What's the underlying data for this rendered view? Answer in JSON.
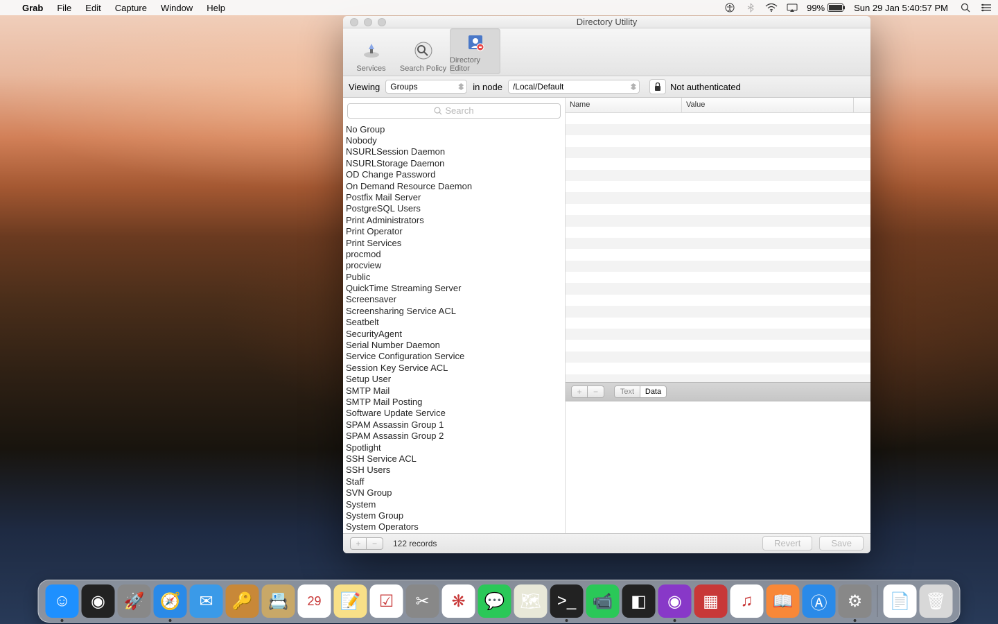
{
  "menubar": {
    "app": "Grab",
    "items": [
      "File",
      "Edit",
      "Capture",
      "Window",
      "Help"
    ],
    "battery": "99%",
    "clock": "Sun 29 Jan  5:40:57 PM"
  },
  "window": {
    "title": "Directory Utility",
    "toolbar": [
      {
        "label": "Services",
        "icon": "services-icon"
      },
      {
        "label": "Search Policy",
        "icon": "search-policy-icon"
      },
      {
        "label": "Directory Editor",
        "icon": "directory-editor-icon",
        "selected": true
      }
    ],
    "filter": {
      "viewing_label": "Viewing",
      "viewing_value": "Groups",
      "in_node_label": "in node",
      "node_value": "/Local/Default",
      "auth_status": "Not authenticated"
    },
    "search_placeholder": "Search",
    "groups": [
      "No Group",
      "Nobody",
      "NSURLSession Daemon",
      "NSURLStorage Daemon",
      "OD Change Password",
      "On Demand Resource Daemon",
      "Postfix Mail Server",
      "PostgreSQL Users",
      "Print Administrators",
      "Print Operator",
      "Print Services",
      "procmod",
      "procview",
      "Public",
      "QuickTime Streaming Server",
      "Screensaver",
      "Screensharing Service ACL",
      "Seatbelt",
      "SecurityAgent",
      "Serial Number Daemon",
      "Service Configuration Service",
      "Session Key Service ACL",
      "Setup User",
      "SMTP Mail",
      "SMTP Mail Posting",
      "Software Update Service",
      "SPAM Assassin Group 1",
      "SPAM Assassin Group 2",
      "Spotlight",
      "SSH Service ACL",
      "SSH Users",
      "Staff",
      "SVN Group",
      "System",
      "System Group",
      "System Operators"
    ],
    "table_headers": {
      "name": "Name",
      "value": "Value"
    },
    "seg": {
      "text": "Text",
      "data": "Data"
    },
    "record_count": "122 records",
    "buttons": {
      "revert": "Revert",
      "save": "Save",
      "plus": "+",
      "minus": "−"
    }
  },
  "dock": {
    "apps": [
      "finder",
      "siri",
      "launchpad",
      "safari",
      "mail",
      "keychain",
      "contacts",
      "calendar",
      "notes",
      "reminders",
      "utility",
      "photos",
      "messages",
      "maps",
      "terminal",
      "facetime",
      "dashboard",
      "activity-monitor",
      "dock-icon-a",
      "itunes",
      "ibooks",
      "appstore",
      "system-preferences"
    ],
    "right": [
      "textedit-doc",
      "trash"
    ]
  }
}
